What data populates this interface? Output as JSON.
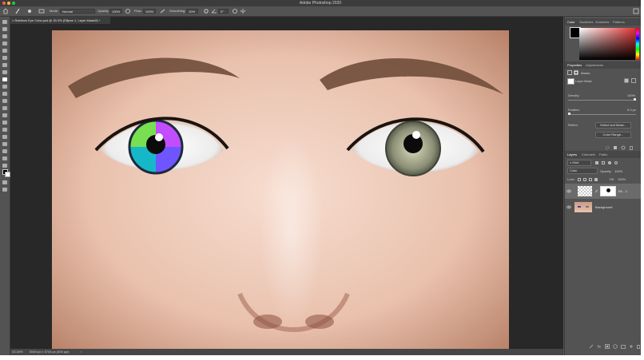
{
  "app": {
    "title": "Adobe Photoshop 2020"
  },
  "options": {
    "mode_label": "Mode:",
    "mode_value": "Normal",
    "opacity_label": "Opacity:",
    "opacity_value": "100%",
    "flow_label": "Flow:",
    "flow_value": "100%",
    "smoothing_label": "Smoothing:",
    "smoothing_value": "10%",
    "angle_value": "0°"
  },
  "document": {
    "tab_label": "Rainbow Eye Color.psd @ 33.3% (Ellipse 1, Layer Mask/8) *",
    "zoom": "33.33%",
    "doc_size": "5544 px x 3744 px (300 ppi)"
  },
  "panels": {
    "top_tabs": [
      "Color",
      "Swatches",
      "Gradients",
      "Patterns"
    ],
    "props_tabs": [
      "Properties",
      "Adjustments"
    ],
    "masks_title": "Masks",
    "layer_mask_label": "Layer Mask",
    "density_label": "Density:",
    "density_value": "100%",
    "feather_label": "Feather:",
    "feather_value": "0.0 px",
    "refine_label": "Refine:",
    "select_mask_button": "Select and Mask...",
    "color_range_button": "Color Range...",
    "layers_tabs": [
      "Layers",
      "Channels",
      "Paths"
    ],
    "kind_label": "Kind",
    "blend_mode": "Color",
    "layer_opacity_label": "Opacity:",
    "layer_opacity_value": "100%",
    "lock_label": "Lock:",
    "fill_label": "Fill:",
    "fill_value": "100%",
    "layers": [
      {
        "name": "Ell... 1",
        "selected": true
      },
      {
        "name": "Background",
        "selected": false
      }
    ]
  },
  "colors": {
    "accent": "#e33535",
    "panel_bg": "#535353",
    "canvas_bg": "#282828",
    "selected_layer": "#6b6b6b"
  }
}
